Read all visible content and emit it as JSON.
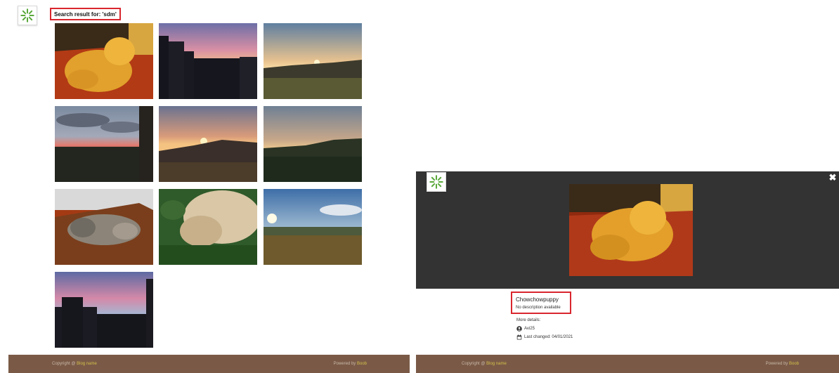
{
  "search": {
    "label": "Search result for: 'sdm'"
  },
  "thumbnails": [
    {
      "subject": "chow-chow-dog"
    },
    {
      "subject": "city-sunset-buildings"
    },
    {
      "subject": "valley-sunset"
    },
    {
      "subject": "cloudy-sunset-town"
    },
    {
      "subject": "mountain-sunset"
    },
    {
      "subject": "dusk-hills"
    },
    {
      "subject": "sleeping-cat"
    },
    {
      "subject": "dog-on-grass"
    },
    {
      "subject": "sun-over-field"
    },
    {
      "subject": "city-dusk-skyline"
    }
  ],
  "footer_left": {
    "copyright_prefix": "Copyright @",
    "copyright_brand": "Blog name",
    "powered_prefix": "Powered by",
    "powered_brand": "Boob"
  },
  "viewer": {
    "photo_title": "Chowchowpuppy",
    "photo_description": "No description available",
    "more_details_label": "More details:",
    "author": "Avi25",
    "last_changed": "Last changed: 04/01/2021",
    "close_icon": "close-icon"
  },
  "footer_right": {
    "copyright_prefix": "Copyright @",
    "copyright_brand": "Blog name",
    "powered_prefix": "Powered by",
    "powered_brand": "Boob"
  },
  "colors": {
    "highlight": "#d9262e",
    "footer": "#7a5a47",
    "viewer_bg": "#333333",
    "logo_green": "#5aa83a"
  }
}
